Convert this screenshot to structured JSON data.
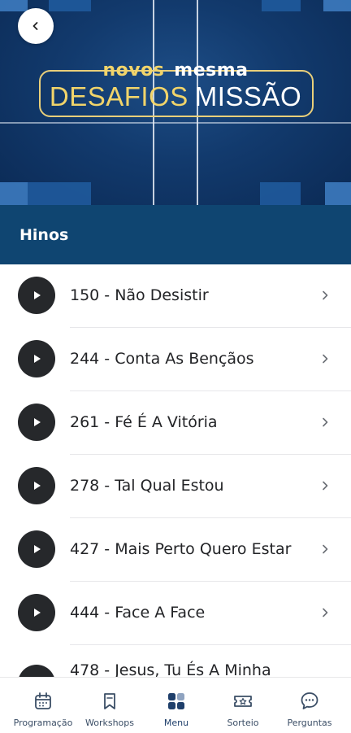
{
  "banner": {
    "logo_line1_word1": "novos",
    "logo_line1_word2": "mesma",
    "logo_line2_word1": "DESAFIOS",
    "logo_line2_word2": "MISSÃO",
    "accent_gold": "#f1d46a",
    "background_navy": "#123a6d"
  },
  "header": {
    "back_icon": "chevron-left-icon",
    "section_title": "Hinos",
    "section_bg": "#0f4571"
  },
  "hymns": [
    {
      "label": "150 - Não Desistir"
    },
    {
      "label": "244 - Conta As Bençãos"
    },
    {
      "label": "261 - Fé É A Vitória"
    },
    {
      "label": "278 - Tal Qual Estou"
    },
    {
      "label": "427 - Mais Perto Quero Estar"
    },
    {
      "label": "444 - Face A Face"
    },
    {
      "label": "478 - Jesus, Tu És A Minha"
    }
  ],
  "tabbar": {
    "tabs": [
      {
        "label": "Programação",
        "icon": "calendar-icon",
        "active": false
      },
      {
        "label": "Workshops",
        "icon": "bookmark-icon",
        "active": false
      },
      {
        "label": "Menu",
        "icon": "grid-icon",
        "active": true
      },
      {
        "label": "Sorteio",
        "icon": "ticket-star-icon",
        "active": false
      },
      {
        "label": "Perguntas",
        "icon": "chat-icon",
        "active": false
      }
    ],
    "active_color": "#1f3f6b",
    "inactive_color": "#3b4e66"
  }
}
